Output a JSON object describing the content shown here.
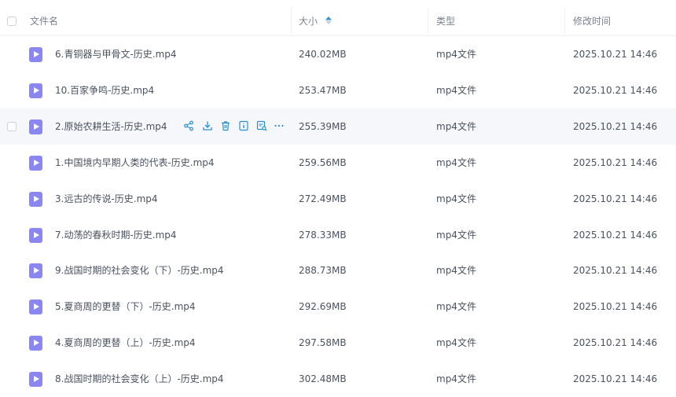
{
  "header": {
    "name_label": "文件名",
    "size_label": "大小",
    "type_label": "类型",
    "time_label": "修改时间"
  },
  "rows": [
    {
      "name": "6.青铜器与甲骨文-历史.mp4",
      "size": "240.02MB",
      "type": "mp4文件",
      "time": "2025.10.21 14:46"
    },
    {
      "name": "10.百家争鸣-历史.mp4",
      "size": "253.47MB",
      "type": "mp4文件",
      "time": "2025.10.21 14:46"
    },
    {
      "name": "2.原始农耕生活-历史.mp4",
      "size": "255.39MB",
      "type": "mp4文件",
      "time": "2025.10.21 14:46"
    },
    {
      "name": "1.中国境内早期人类的代表-历史.mp4",
      "size": "259.56MB",
      "type": "mp4文件",
      "time": "2025.10.21 14:46"
    },
    {
      "name": "3.远古的传说-历史.mp4",
      "size": "272.49MB",
      "type": "mp4文件",
      "time": "2025.10.21 14:46"
    },
    {
      "name": "7.动荡的春秋时期-历史.mp4",
      "size": "278.33MB",
      "type": "mp4文件",
      "time": "2025.10.21 14:46"
    },
    {
      "name": "9.战国时期的社会变化（下）-历史.mp4",
      "size": "288.73MB",
      "type": "mp4文件",
      "time": "2025.10.21 14:46"
    },
    {
      "name": "5.夏商周的更替（下）-历史.mp4",
      "size": "292.69MB",
      "type": "mp4文件",
      "time": "2025.10.21 14:46"
    },
    {
      "name": "4.夏商周的更替（上）-历史.mp4",
      "size": "297.58MB",
      "type": "mp4文件",
      "time": "2025.10.21 14:46"
    },
    {
      "name": "8.战国时期的社会变化（上）-历史.mp4",
      "size": "302.48MB",
      "type": "mp4文件",
      "time": "2025.10.21 14:46"
    }
  ],
  "hovered_row_index": 2,
  "colors": {
    "accent": "#2a8fd1",
    "file_icon": "#8a86f2",
    "hover_bg": "#f5f7fb"
  },
  "row_actions": [
    "share-icon",
    "download-icon",
    "delete-icon",
    "info-icon",
    "image-search-icon",
    "more-icon"
  ]
}
